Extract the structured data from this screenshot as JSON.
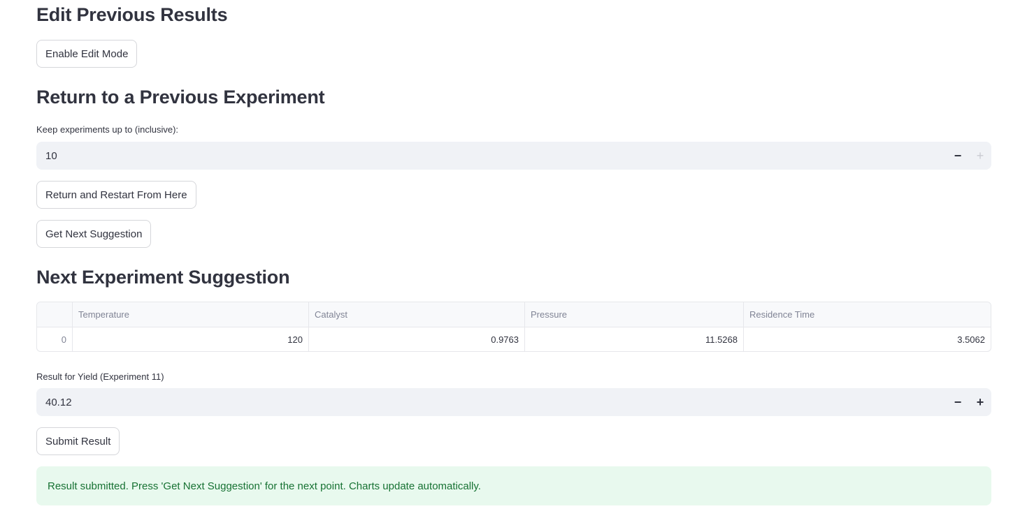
{
  "edit_section": {
    "heading": "Edit Previous Results",
    "enable_edit_button": "Enable Edit Mode"
  },
  "return_section": {
    "heading": "Return to a Previous Experiment",
    "keep_label": "Keep experiments up to (inclusive):",
    "keep_value": "10",
    "return_button": "Return and Restart From Here",
    "next_button": "Get Next Suggestion"
  },
  "suggestion_section": {
    "heading": "Next Experiment Suggestion",
    "table": {
      "columns": [
        "",
        "Temperature",
        "Catalyst",
        "Pressure",
        "Residence Time"
      ],
      "rows": [
        [
          "0",
          "120",
          "0.9763",
          "11.5268",
          "3.5062"
        ]
      ]
    }
  },
  "result_section": {
    "label": "Result for Yield (Experiment 11)",
    "value": "40.12",
    "submit_button": "Submit Result",
    "success_message": "Result submitted. Press 'Get Next Suggestion' for the next point. Charts update automatically."
  },
  "icons": {
    "minus": "−",
    "plus": "+"
  }
}
